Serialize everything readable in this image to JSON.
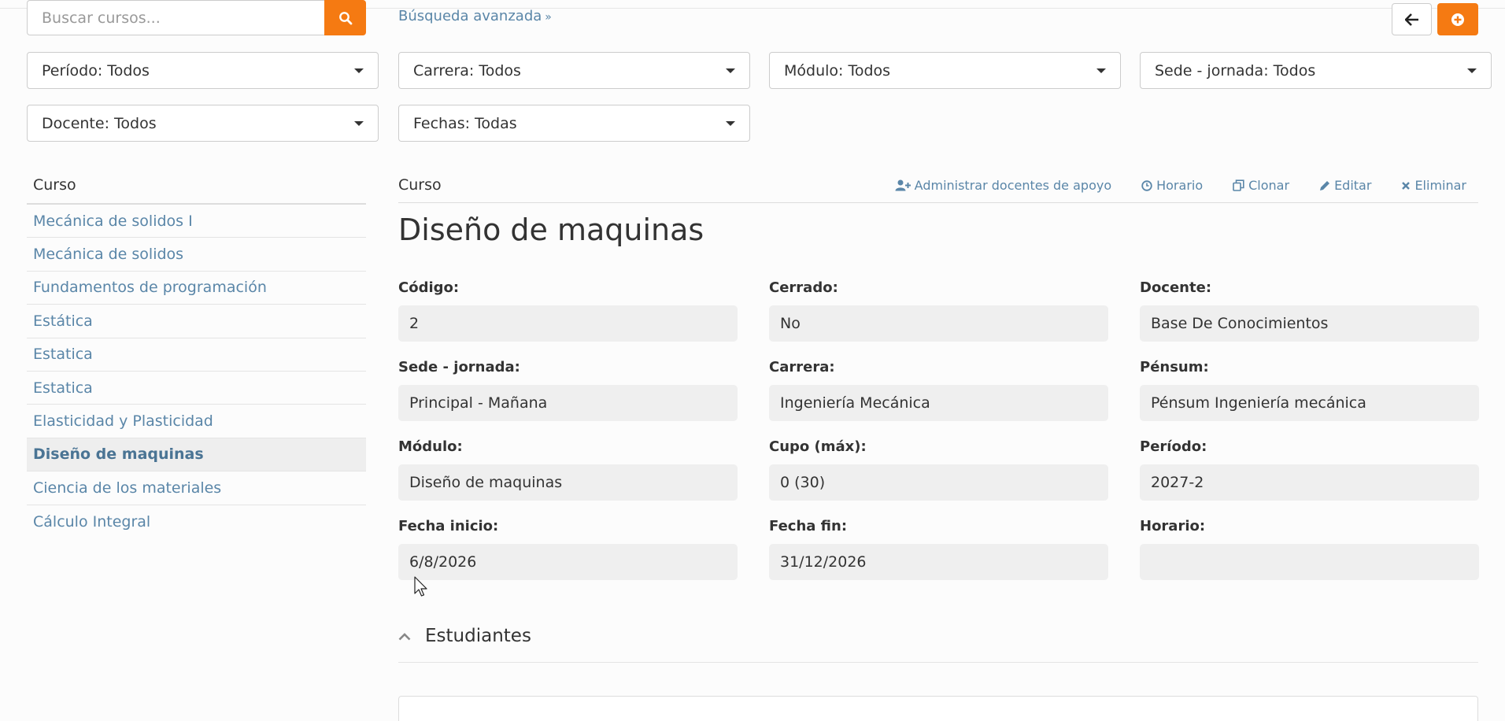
{
  "search": {
    "placeholder": "Buscar cursos...",
    "button_icon": "search-icon"
  },
  "advanced_search": "Búsqueda avanzada",
  "top_buttons": {
    "back_icon": "arrow-left-icon",
    "add_icon": "plus-circle-icon"
  },
  "filters": {
    "periodo": "Período: Todos",
    "carrera": "Carrera: Todos",
    "modulo": "Módulo: Todos",
    "sede": "Sede - jornada: Todos",
    "docente": "Docente: Todos",
    "fechas": "Fechas: Todas"
  },
  "course_list": {
    "header": "Curso",
    "items": [
      "Mecánica de solidos I",
      "Mecánica de solidos",
      "Fundamentos de programación",
      "Estática",
      "Estatica",
      "Estatica",
      "Elasticidad y Plasticidad",
      "Diseño de maquinas",
      "Ciencia de los materiales",
      "Cálculo Integral"
    ],
    "active_index": 7
  },
  "detail": {
    "header": "Curso",
    "actions": {
      "manage_support": "Administrar docentes de apoyo",
      "schedule": "Horario",
      "clone": "Clonar",
      "edit": "Editar",
      "delete": "Eliminar"
    },
    "title": "Diseño de maquinas",
    "fields": {
      "codigo": {
        "label": "Código:",
        "value": "2"
      },
      "cerrado": {
        "label": "Cerrado:",
        "value": "No"
      },
      "docente": {
        "label": "Docente:",
        "value": "Base De Conocimientos"
      },
      "sede": {
        "label": "Sede - jornada:",
        "value": "Principal - Mañana"
      },
      "carrera": {
        "label": "Carrera:",
        "value": "Ingeniería Mecánica"
      },
      "pensum": {
        "label": "Pénsum:",
        "value": "Pénsum Ingeniería mecánica"
      },
      "modulo": {
        "label": "Módulo:",
        "value": "Diseño de maquinas"
      },
      "cupo": {
        "label": "Cupo (máx):",
        "value": "0 (30)"
      },
      "periodo": {
        "label": "Período:",
        "value": "2027-2"
      },
      "fecha_inicio": {
        "label": "Fecha inicio:",
        "value": "6/8/2026"
      },
      "fecha_fin": {
        "label": "Fecha fin:",
        "value": "31/12/2026"
      },
      "horario": {
        "label": "Horario:",
        "value": ""
      }
    },
    "students_section": "Estudiantes"
  },
  "colors": {
    "accent": "#f57a12",
    "link": "#5a86a8"
  }
}
